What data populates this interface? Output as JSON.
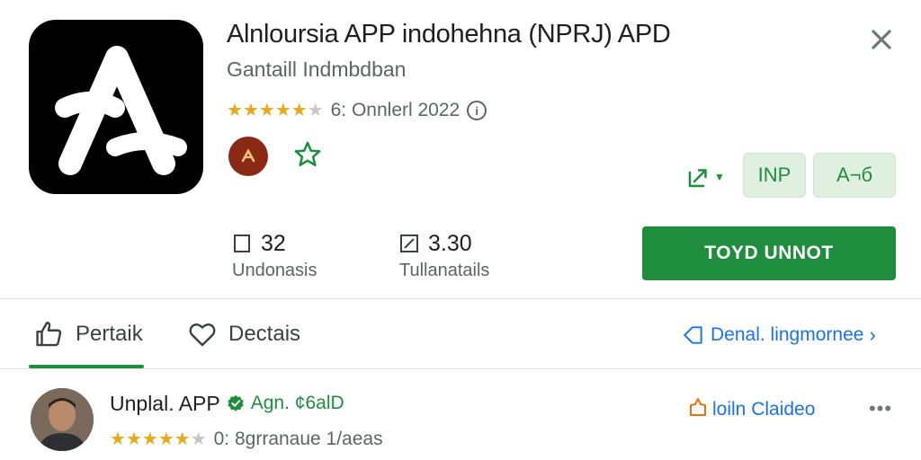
{
  "app": {
    "title": "Alnloursia APP indohehna (NPRJ) APD",
    "subtitle": "Gantaill Indmbdban",
    "icon": "app-logo-icon",
    "rating_stars": 4,
    "rating_text": "6: Onnlerl 2022",
    "accent_color": "#1e8e3e"
  },
  "actions": {
    "pill_1_label": "INP",
    "pill_2_label": "A¬б",
    "install_label": "TOYD UNNOT"
  },
  "stats": [
    {
      "value": "32",
      "label": "Undonasis",
      "icon": "square-icon"
    },
    {
      "value": "3.30",
      "label": "Tullanatails",
      "icon": "edit-square-icon"
    }
  ],
  "tabs": [
    {
      "label": "Pertaik",
      "icon": "thumbs-up-icon"
    },
    {
      "label": "Dectais",
      "icon": "heart-icon"
    }
  ],
  "details_link": "Denal. lingmornee",
  "developer": {
    "name": "Unplal. APP",
    "tag": "Agn. ¢6alD",
    "rating_stars": 4,
    "rating_text": "0: 8grranaue 1/aeas",
    "contact_label": "loiln Claideo",
    "more_label": "•••"
  }
}
